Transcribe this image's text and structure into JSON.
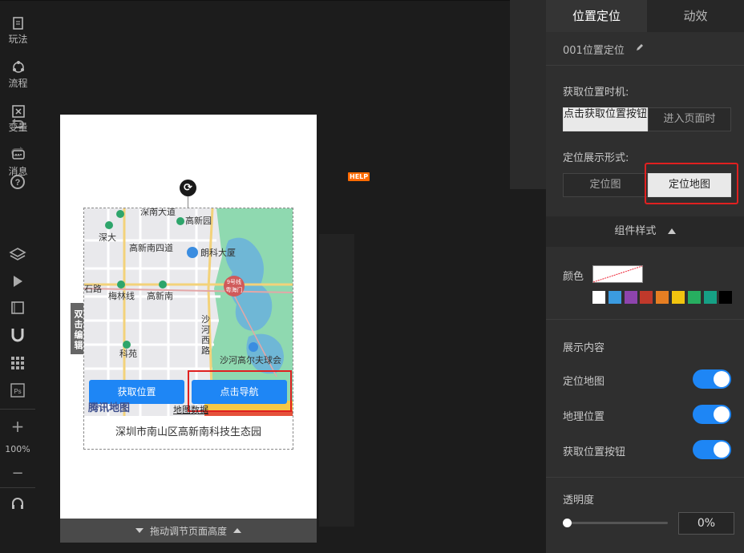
{
  "panel": {
    "tabs": [
      "位置定位",
      "动效"
    ],
    "component_name": "001位置定位",
    "trigger_label": "获取位置时机:",
    "trigger_options": [
      "点击获取位置按钮",
      "进入页面时"
    ],
    "display_label": "定位展示形式:",
    "display_options": [
      "定位图",
      "定位地图"
    ],
    "style_header": "组件样式",
    "color_label": "颜色",
    "display_content_label": "展示内容",
    "toggles": [
      "定位地图",
      "地理位置",
      "获取位置按钮"
    ],
    "opacity_label": "透明度",
    "opacity_value": "0%",
    "swatches": [
      "#ffffff",
      "#3b9be0",
      "#8e44ad",
      "#c0392b",
      "#e67e22",
      "#f1c40f",
      "#27ae60",
      "#16a085",
      "#000000"
    ]
  },
  "mini_sidebar": [
    "玩法",
    "流程",
    "变量",
    "消息"
  ],
  "tools": {
    "help_badge": "HELP",
    "zoom": "100%",
    "zoom_in": "+",
    "zoom_out": "−"
  },
  "canvas": {
    "edit_hint": "双击编辑",
    "footer": "拖动调节页面高度",
    "address": "深圳市南山区高新南科技生态园",
    "buttons": [
      "获取位置",
      "点击导航"
    ],
    "logo": "腾讯地图",
    "map_data": "地图数据",
    "map_labels": [
      "深南大道",
      "高新园",
      "深大",
      "高新南四道",
      "朗科大厦",
      "9号线",
      "梅林线",
      "粤海门",
      "高新南",
      "沙",
      "河",
      "西",
      "路",
      "科苑",
      "沙河高尔夫球会",
      "石路"
    ]
  }
}
